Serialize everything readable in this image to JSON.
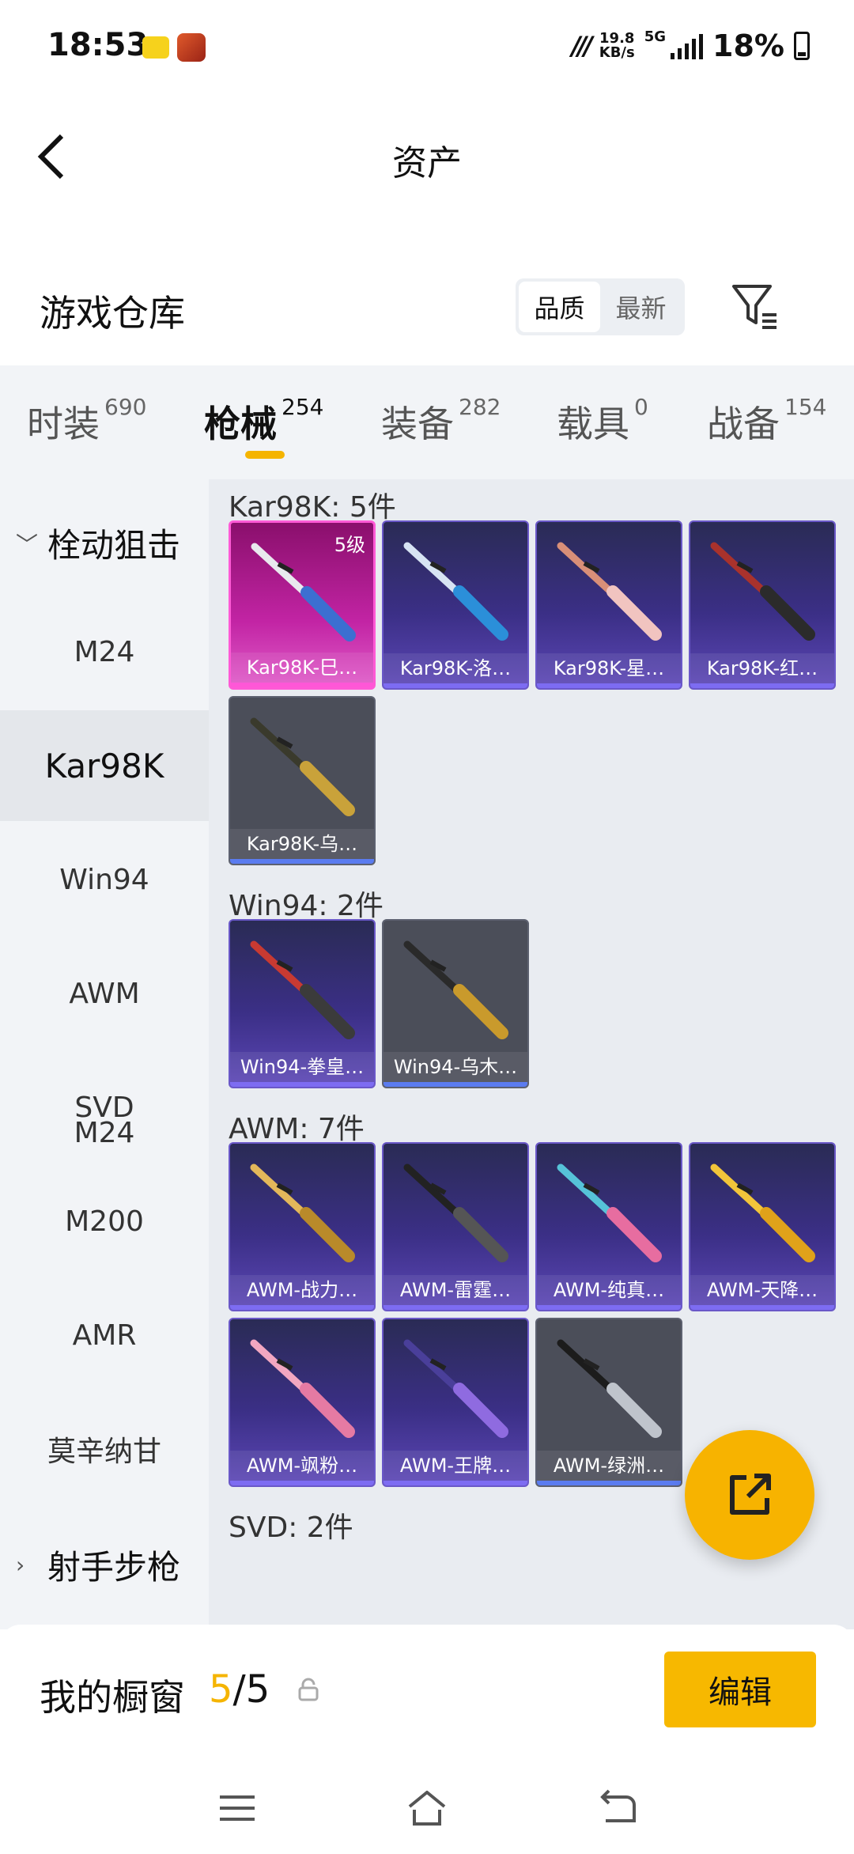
{
  "status": {
    "time": "18:53",
    "speed_value": "19.8",
    "speed_unit": "KB/s",
    "network": "5G",
    "battery": "18%"
  },
  "header": {
    "title": "资产"
  },
  "warehouse": {
    "title": "游戏仓库",
    "sort_options": [
      "品质",
      "最新"
    ],
    "sort_selected": "品质"
  },
  "tabs": [
    {
      "label": "时装",
      "count": "690"
    },
    {
      "label": "枪械",
      "count": "254"
    },
    {
      "label": "装备",
      "count": "282"
    },
    {
      "label": "载具",
      "count": "0"
    },
    {
      "label": "战备",
      "count": "154"
    }
  ],
  "active_tab": "枪械",
  "sidebar": {
    "group_open": "栓动狙击",
    "items": [
      "M24",
      "Kar98K",
      "Win94",
      "AWM",
      "SVD",
      "M200",
      "AMR",
      "莫辛纳甘"
    ],
    "active_item": "Kar98K",
    "group_closed": "射手步枪"
  },
  "groups": [
    {
      "title": "Kar98K: 5件",
      "items": [
        {
          "name": "Kar98K-巳…",
          "level": "5级",
          "rarity": "pink"
        },
        {
          "name": "Kar98K-洛…",
          "rarity": "purple"
        },
        {
          "name": "Kar98K-星…",
          "rarity": "purple"
        },
        {
          "name": "Kar98K-红…",
          "rarity": "purple"
        },
        {
          "name": "Kar98K-乌…",
          "rarity": "gray"
        }
      ]
    },
    {
      "title": "Win94: 2件",
      "items": [
        {
          "name": "Win94-拳皇…",
          "rarity": "purple"
        },
        {
          "name": "Win94-乌木…",
          "rarity": "gray"
        }
      ]
    },
    {
      "title": "AWM: 7件",
      "items": [
        {
          "name": "AWM-战力…",
          "rarity": "purple"
        },
        {
          "name": "AWM-雷霆…",
          "rarity": "purple"
        },
        {
          "name": "AWM-纯真…",
          "rarity": "purple"
        },
        {
          "name": "AWM-天降…",
          "rarity": "purple"
        },
        {
          "name": "AWM-飒粉…",
          "rarity": "purple"
        },
        {
          "name": "AWM-王牌…",
          "rarity": "purple"
        },
        {
          "name": "AWM-绿洲…",
          "rarity": "gray"
        }
      ]
    },
    {
      "title": "SVD: 2件",
      "items": []
    }
  ],
  "showcase": {
    "label": "我的橱窗",
    "current": "5",
    "separator": "/",
    "total": "5",
    "edit_label": "编辑"
  },
  "colors": {
    "accent": "#f7b800",
    "rarity_purple": "#3b2f86",
    "rarity_pink": "#c224a4",
    "rarity_gray": "#4b4e59"
  }
}
